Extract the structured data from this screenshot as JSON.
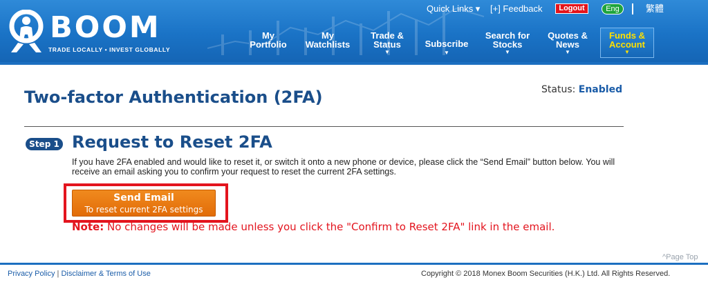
{
  "header": {
    "logo_text": "BOOM",
    "logo_tagline": "TRADE LOCALLY • INVEST GLOBALLY",
    "top_links": {
      "quick_links": "Quick Links ▾",
      "feedback": "[+] Feedback",
      "logout": "Logout",
      "lang_eng": "Eng",
      "lang_tc": "繁體"
    },
    "nav": [
      {
        "line1": "My",
        "line2": "Portfolio",
        "arrow": ""
      },
      {
        "line1": "My",
        "line2": "Watchlists",
        "arrow": ""
      },
      {
        "line1": "Trade &",
        "line2": "Status",
        "arrow": "▼"
      },
      {
        "line1": "Subscribe",
        "line2": "",
        "arrow": "▼"
      },
      {
        "line1": "Search for",
        "line2": "Stocks",
        "arrow": "▼"
      },
      {
        "line1": "Quotes &",
        "line2": "News",
        "arrow": "▼"
      },
      {
        "line1": "Funds &",
        "line2": "Account",
        "arrow": "▼"
      }
    ]
  },
  "main": {
    "page_title": "Two-factor Authentication (2FA)",
    "status_label": "Status:",
    "status_value": "Enabled",
    "step_badge": "Step 1",
    "step_title": "Request to Reset 2FA",
    "step_description": "If you have 2FA enabled and would like to reset it, or switch it onto a new phone or device, please click the “Send Email” button below. You will receive an email asking you to confirm your request to reset the current 2FA settings.",
    "send_button": {
      "label": "Send Email",
      "sublabel": "To reset current 2FA settings"
    },
    "note_label": "Note:",
    "note_text": "No changes will be made unless you click the \"Confirm to Reset 2FA\" link in the email."
  },
  "footer": {
    "page_top": "^Page Top",
    "privacy": "Privacy Policy",
    "disclaimer": "Disclaimer & Terms of Use",
    "copyright": "Copyright © 2018 Monex Boom Securities (H.K.) Ltd. All Rights Reserved."
  },
  "colors": {
    "header_blue": "#1a73c6",
    "title_navy": "#1a4e8a",
    "accent_orange": "#e26c08",
    "alert_red": "#e3141e",
    "active_nav_text": "#ffe000"
  }
}
